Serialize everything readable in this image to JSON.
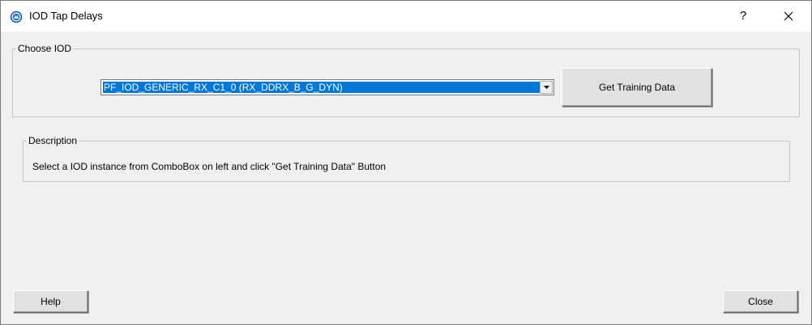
{
  "window": {
    "title": "IOD Tap Delays",
    "help_glyph": "?",
    "close_glyph_icon": "close-x-icon",
    "app_icon": "app-gear-icon"
  },
  "choose_iod": {
    "group_label": "Choose IOD",
    "combo_selected": "PF_IOD_GENERIC_RX_C1_0 (RX_DDRX_B_G_DYN)",
    "get_training_label": "Get Training Data"
  },
  "description": {
    "group_label": "Description",
    "text": "Select a IOD instance from ComboBox on left and click \"Get Training Data\" Button"
  },
  "footer": {
    "help_label": "Help",
    "close_label": "Close"
  },
  "colors": {
    "selection": "#0078d7",
    "window_bg": "#f0f0f0",
    "titlebar_bg": "#ffffff"
  }
}
